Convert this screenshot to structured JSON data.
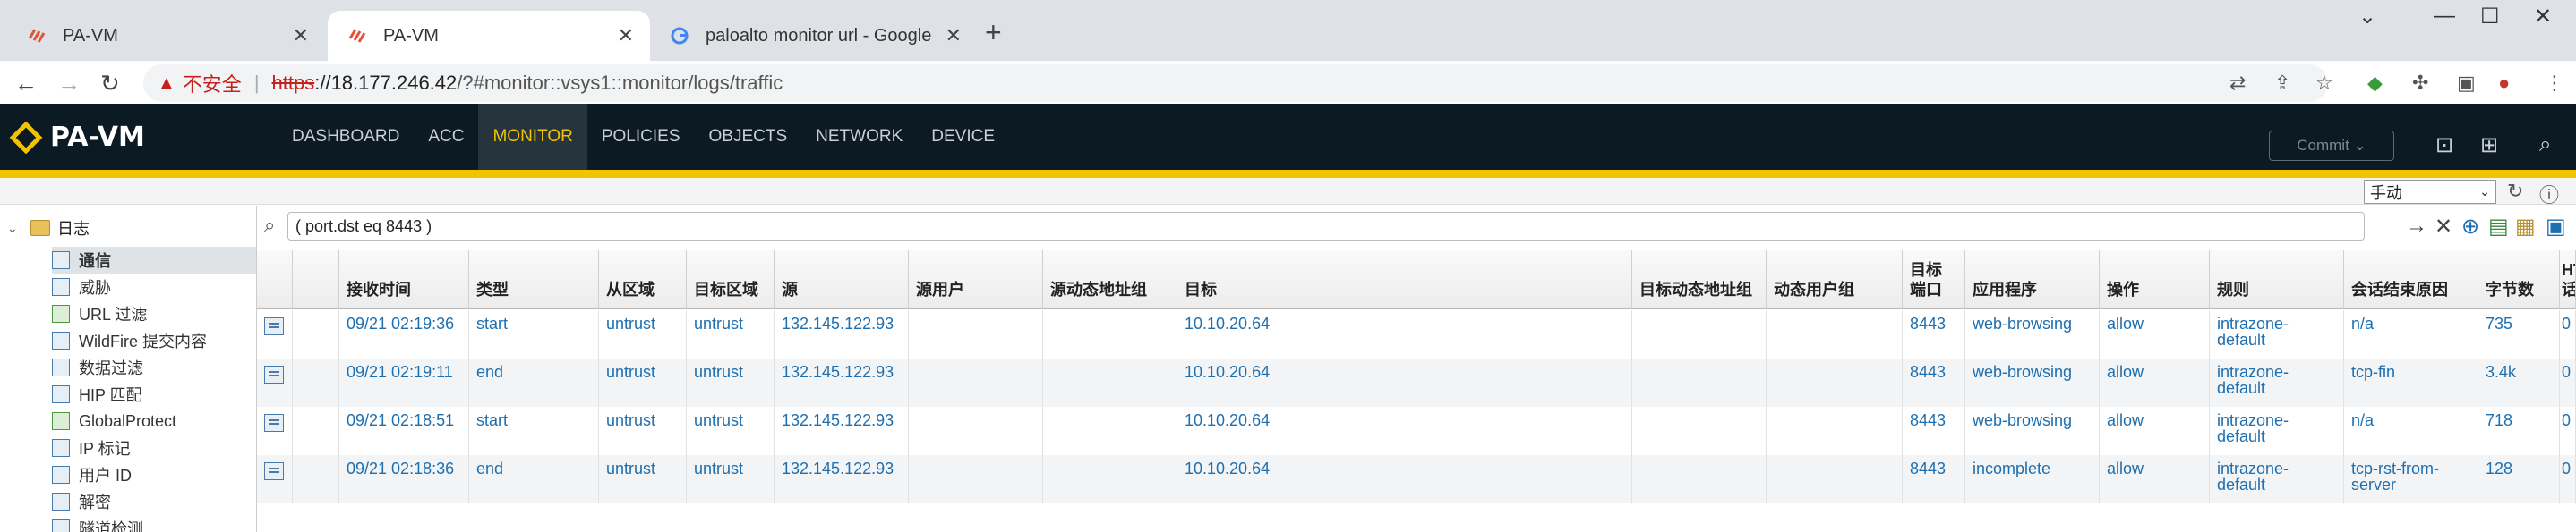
{
  "browser": {
    "tabs": [
      {
        "title": "PA-VM",
        "active": false
      },
      {
        "title": "PA-VM",
        "active": true
      },
      {
        "title": "paloalto monitor url - Google",
        "active": false
      }
    ],
    "new_tab": "+",
    "address": {
      "security_label": "不安全",
      "scheme": "https",
      "host": "://18.177.246.42",
      "path": "/?#monitor::vsys1::monitor/logs/traffic"
    }
  },
  "app": {
    "logo": "PA-VM",
    "menu": [
      "DASHBOARD",
      "ACC",
      "MONITOR",
      "POLICIES",
      "OBJECTS",
      "NETWORK",
      "DEVICE"
    ],
    "active_menu": "MONITOR",
    "commit_label": "Commit",
    "refresh_mode": "手动"
  },
  "sidebar": {
    "root_label": "日志",
    "items": [
      {
        "label": "通信",
        "active": true
      },
      {
        "label": "威胁"
      },
      {
        "label": "URL 过滤"
      },
      {
        "label": "WildFire 提交内容"
      },
      {
        "label": "数据过滤"
      },
      {
        "label": "HIP 匹配"
      },
      {
        "label": "GlobalProtect"
      },
      {
        "label": "IP 标记"
      },
      {
        "label": "用户 ID"
      },
      {
        "label": "解密"
      },
      {
        "label": "隧道检测"
      }
    ]
  },
  "filter": {
    "value": "( port.dst eq 8443 )"
  },
  "table": {
    "columns": [
      "接收时间",
      "类型",
      "从区域",
      "目标区域",
      "源",
      "源用户",
      "源动态地址组",
      "目标",
      "目标动态地址组",
      "动态用户组",
      "目标\n端口",
      "应用程序",
      "操作",
      "规则",
      "会话结束原因",
      "字节数",
      "HT\n话"
    ],
    "rows": [
      {
        "time": "09/21 02:19:36",
        "type": "start",
        "from_zone": "untrust",
        "to_zone": "untrust",
        "src": "132.145.122.93",
        "src_user": "",
        "src_dag": "",
        "dst": "10.10.20.64",
        "dst_dag": "",
        "dug": "",
        "port": "8443",
        "app": "web-browsing",
        "action": "allow",
        "rule": "intrazone-\ndefault",
        "end_reason": "n/a",
        "bytes": "735",
        "ht": "0"
      },
      {
        "time": "09/21 02:19:11",
        "type": "end",
        "from_zone": "untrust",
        "to_zone": "untrust",
        "src": "132.145.122.93",
        "src_user": "",
        "src_dag": "",
        "dst": "10.10.20.64",
        "dst_dag": "",
        "dug": "",
        "port": "8443",
        "app": "web-browsing",
        "action": "allow",
        "rule": "intrazone-\ndefault",
        "end_reason": "tcp-fin",
        "bytes": "3.4k",
        "ht": "0"
      },
      {
        "time": "09/21 02:18:51",
        "type": "start",
        "from_zone": "untrust",
        "to_zone": "untrust",
        "src": "132.145.122.93",
        "src_user": "",
        "src_dag": "",
        "dst": "10.10.20.64",
        "dst_dag": "",
        "dug": "",
        "port": "8443",
        "app": "web-browsing",
        "action": "allow",
        "rule": "intrazone-\ndefault",
        "end_reason": "n/a",
        "bytes": "718",
        "ht": "0"
      },
      {
        "time": "09/21 02:18:36",
        "type": "end",
        "from_zone": "untrust",
        "to_zone": "untrust",
        "src": "132.145.122.93",
        "src_user": "",
        "src_dag": "",
        "dst": "10.10.20.64",
        "dst_dag": "",
        "dug": "",
        "port": "8443",
        "app": "incomplete",
        "action": "allow",
        "rule": "intrazone-\ndefault",
        "end_reason": "tcp-rst-from-\nserver",
        "bytes": "128",
        "ht": "0"
      }
    ]
  },
  "colors": {
    "appbar": "#0c1a24",
    "accent": "#f2c400",
    "link": "#1e6fb0"
  }
}
